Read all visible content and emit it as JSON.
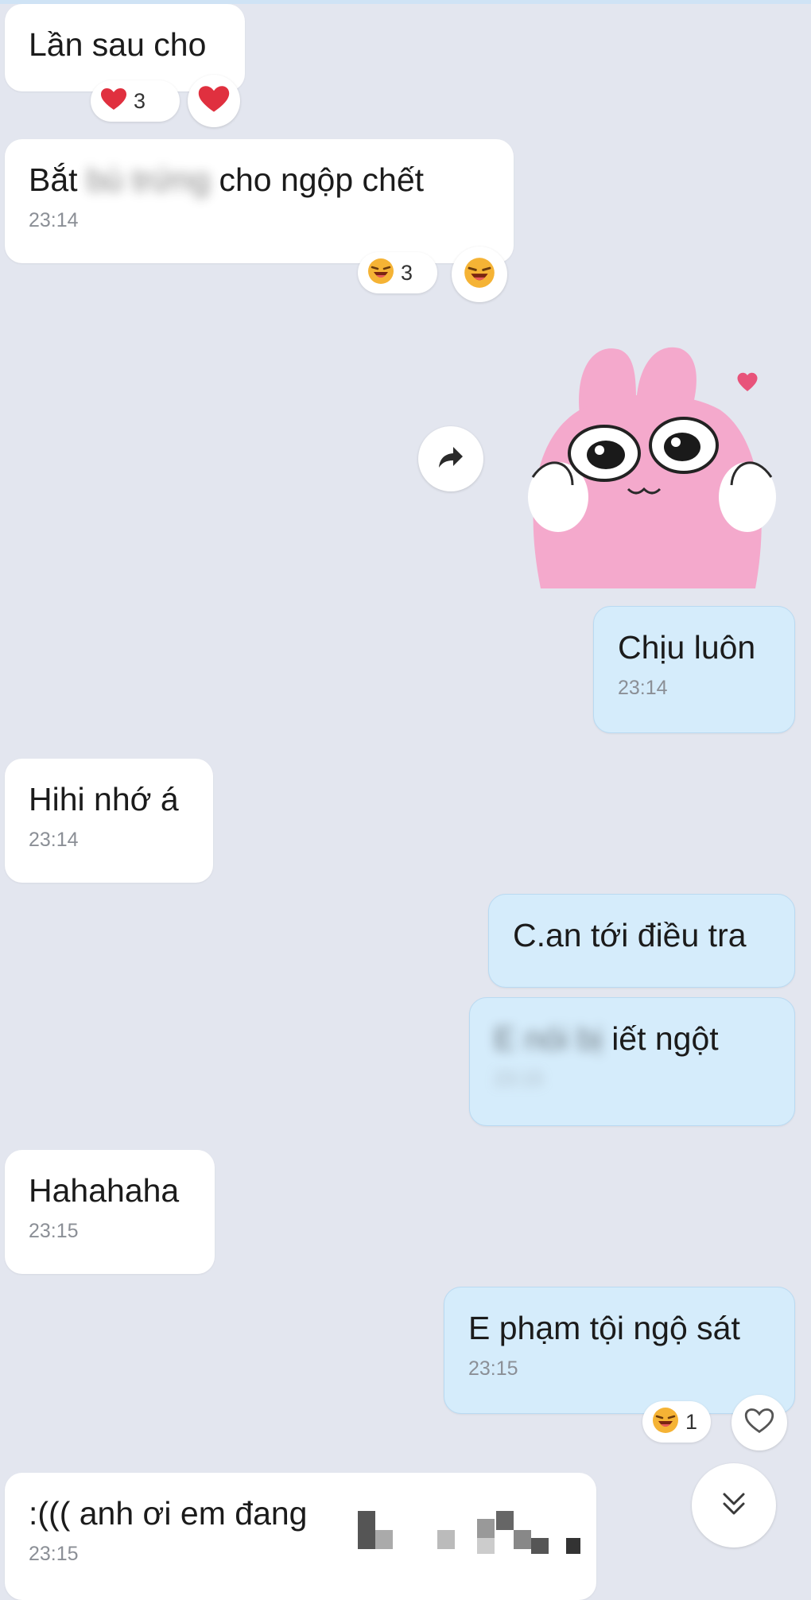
{
  "messages": [
    {
      "id": "m1",
      "side": "in",
      "text": "Lần sau cho",
      "time": ""
    },
    {
      "id": "m2",
      "side": "in",
      "text_a": "Bắt",
      "text_blur": "bù trứng",
      "text_b": "cho ngộp chết",
      "time": "23:14"
    },
    {
      "id": "m3",
      "side": "out",
      "text": "Chịu luôn",
      "time": "23:14"
    },
    {
      "id": "m4",
      "side": "in",
      "text": "Hihi nhớ á",
      "time": "23:14"
    },
    {
      "id": "m5",
      "side": "out",
      "text": "C.an tới điều tra",
      "time": ""
    },
    {
      "id": "m6",
      "side": "out",
      "text_a": "E",
      "text_blur": "nói bị",
      "text_b": "iết ngột",
      "time": "23:15"
    },
    {
      "id": "m7",
      "side": "in",
      "text": "Hahahaha",
      "time": "23:15"
    },
    {
      "id": "m8",
      "side": "out",
      "text": "E phạm tội ngộ sát",
      "time": "23:15"
    },
    {
      "id": "m9",
      "side": "in",
      "text": ":((( anh ơi em đang",
      "time": "23:15"
    }
  ],
  "reactions": {
    "m1": {
      "icon": "heart",
      "count": "3"
    },
    "m2": {
      "icon": "laughing-face",
      "count": "3"
    },
    "m8": {
      "icon": "laughing-face",
      "count": "1"
    }
  },
  "colors": {
    "background": "#e3e6ef",
    "incoming_bubble": "#ffffff",
    "outgoing_bubble": "#d5ecfb",
    "heart": "#e0303f",
    "sticker_pink": "#f4a9cc"
  },
  "sticker": {
    "icon": "pink-bunny-sticker"
  }
}
